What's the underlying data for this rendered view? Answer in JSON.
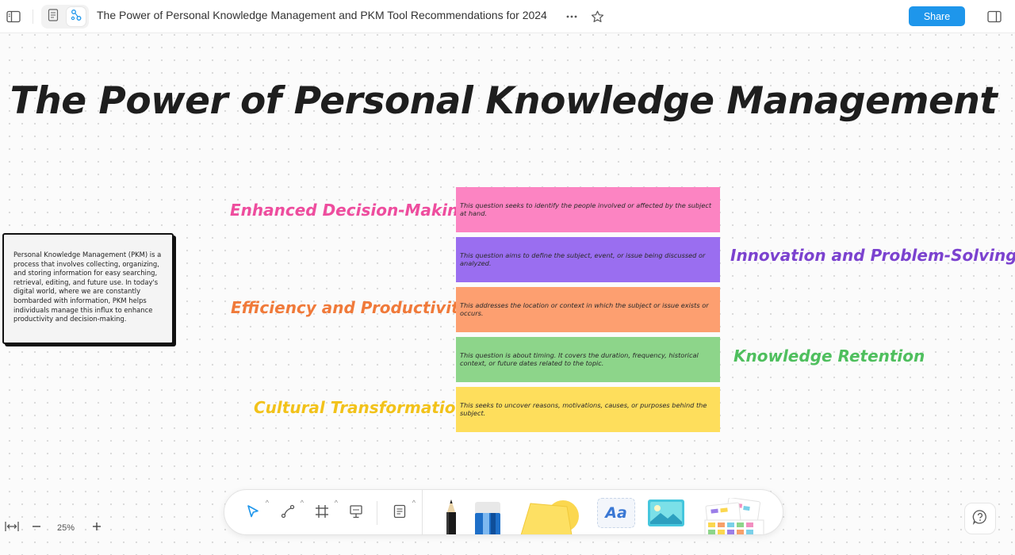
{
  "topbar": {
    "title": "The Power of Personal Knowledge Management and PKM Tool Recommendations for 2024",
    "share_label": "Share",
    "icons": [
      "sidebar-toggle-icon",
      "document-mode-icon",
      "whiteboard-mode-icon",
      "more-icon",
      "star-icon",
      "panel-right-icon"
    ]
  },
  "canvas": {
    "main_title": "The Power of Personal Knowledge Management",
    "info_card": "Personal Knowledge Management (PKM) is a process that involves collecting, organizing, and storing information for easy searching, retrieval, editing, and future use. In today's digital world, where we are constantly bombarded with information, PKM helps individuals manage this influx to enhance productivity and decision-making.",
    "labels": [
      {
        "text": "Enhanced Decision-Making",
        "color": "#ee4d9e"
      },
      {
        "text": "Innovation and Problem-Solving",
        "color": "#7b42cf"
      },
      {
        "text": "Efficiency and Productivity",
        "color": "#f07a3a"
      },
      {
        "text": "Knowledge Retention",
        "color": "#4fbf5e"
      },
      {
        "text": "Cultural Transformation",
        "color": "#f2c21a"
      }
    ],
    "stickies": [
      {
        "text": "This question seeks to identify the people involved or affected by the subject at hand.",
        "color": "#fc84c2"
      },
      {
        "text": "This question aims to define the subject, event, or issue being discussed or analyzed.",
        "color": "#9a6ef0"
      },
      {
        "text": "This addresses the location or context in which the subject or issue exists or occurs.",
        "color": "#fd9f70"
      },
      {
        "text": "This question is about timing. It covers the duration, frequency, historical context, or future dates related to the topic.",
        "color": "#8dd58a"
      },
      {
        "text": "This seeks to uncover reasons, motivations, causes, or purposes behind the subject.",
        "color": "#fede5c"
      }
    ]
  },
  "toolbar": {
    "text_tool_label": "Aa",
    "tools": [
      "select-icon",
      "connector-icon",
      "frame-icon",
      "presentation-icon",
      "note-icon",
      "pen-icon",
      "marker-icon",
      "shape-icon",
      "text-icon",
      "image-icon",
      "template-icon"
    ]
  },
  "zoom": {
    "level": "25%"
  },
  "accent_color": "#1e96eb"
}
